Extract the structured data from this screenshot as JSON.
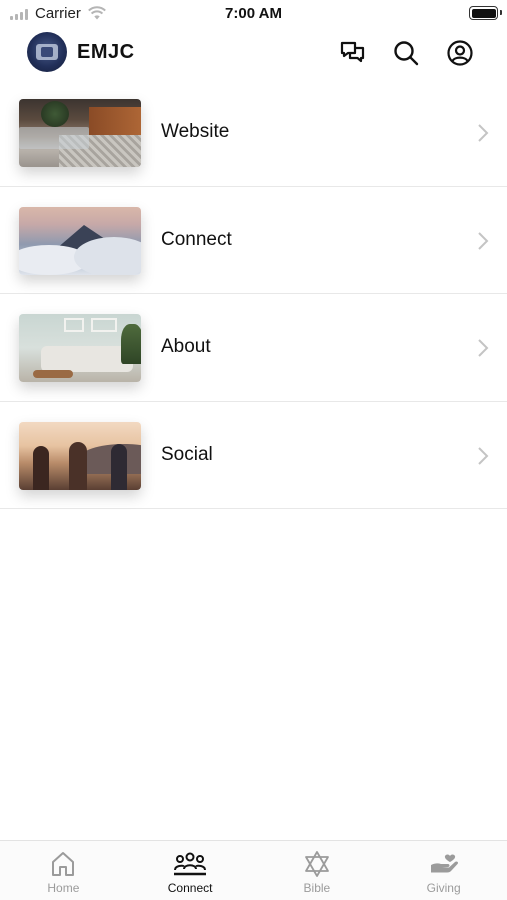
{
  "status_bar": {
    "carrier": "Carrier",
    "time": "7:00 AM"
  },
  "header": {
    "title": "EMJC",
    "icons": [
      "chat-icon",
      "search-icon",
      "profile-icon"
    ]
  },
  "menu": {
    "items": [
      {
        "label": "Website",
        "thumbnail": "living-room-photo"
      },
      {
        "label": "Connect",
        "thumbnail": "mountains-clouds-photo"
      },
      {
        "label": "About",
        "thumbnail": "sofa-room-photo"
      },
      {
        "label": "Social",
        "thumbnail": "friends-sunset-photo"
      }
    ]
  },
  "tab_bar": {
    "tabs": [
      {
        "label": "Home",
        "icon": "home-icon",
        "active": false
      },
      {
        "label": "Connect",
        "icon": "people-icon",
        "active": true
      },
      {
        "label": "Bible",
        "icon": "star-of-david-icon",
        "active": false
      },
      {
        "label": "Giving",
        "icon": "giving-hand-icon",
        "active": false
      }
    ]
  },
  "colors": {
    "active_tab": "#111111",
    "inactive_tab": "#9b9b9b",
    "divider": "#e8e8e8",
    "logo": "#22305a"
  }
}
